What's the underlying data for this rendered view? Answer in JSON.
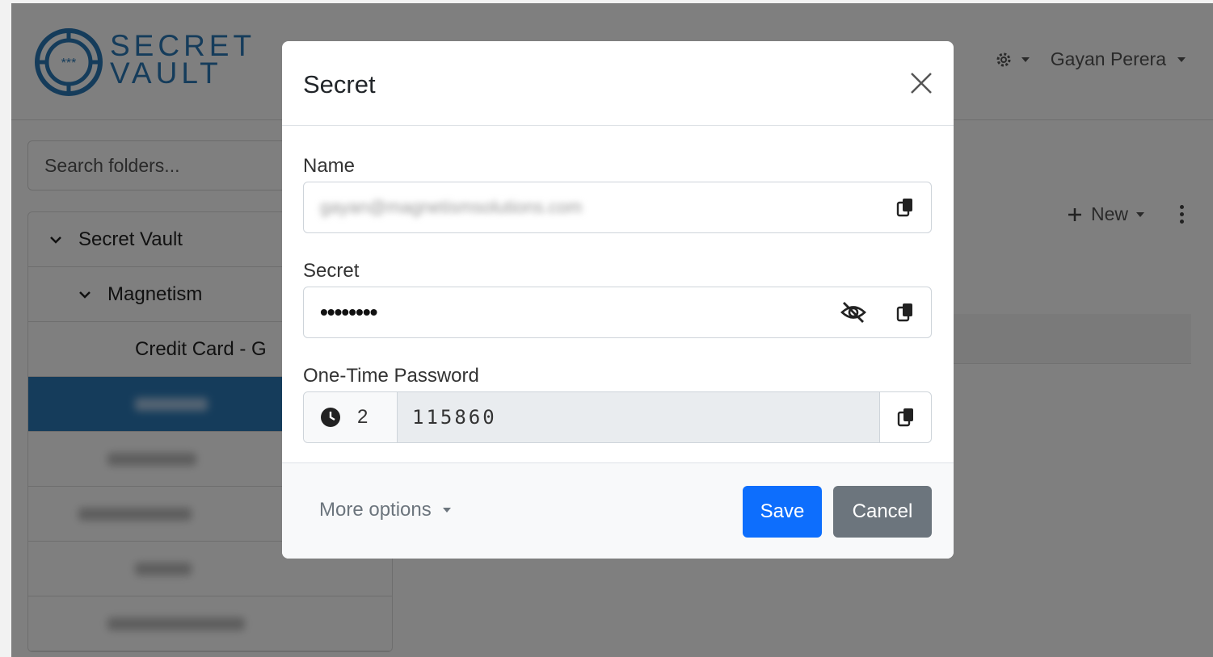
{
  "header": {
    "logo_line1": "SECRET",
    "logo_line2": "VAULT",
    "user_name": "Gayan Perera"
  },
  "sidebar": {
    "search_placeholder": "Search folders...",
    "items": [
      {
        "label": "Secret Vault",
        "level": 0,
        "expanded": true
      },
      {
        "label": "Magnetism",
        "level": 1,
        "expanded": true
      },
      {
        "label": "Credit Card - G",
        "level": 2
      },
      {
        "label": "",
        "level": 2,
        "active": true,
        "blurred": true
      },
      {
        "label": "",
        "level": 2,
        "blurred": true
      },
      {
        "label": "",
        "level": 1,
        "blurred": true
      },
      {
        "label": "",
        "level": 2,
        "blurred": true
      },
      {
        "label": "",
        "level": 2,
        "blurred": true
      }
    ]
  },
  "toolbar": {
    "new_label": "New"
  },
  "modal": {
    "title": "Secret",
    "name_label": "Name",
    "name_value": "gayan@magnetismsolutions.com",
    "secret_label": "Secret",
    "secret_value": "••••••••",
    "otp_label": "One-Time Password",
    "otp_seconds": "2",
    "otp_code": "115860",
    "more_options": "More options",
    "save_label": "Save",
    "cancel_label": "Cancel"
  },
  "colors": {
    "brand": "#2b79b7",
    "primary": "#0d6efd",
    "secondary": "#6c757d"
  },
  "icons": [
    "close-icon",
    "copy-icon",
    "eye-slash-icon",
    "clock-icon",
    "gear-icon",
    "plus-icon",
    "kebab-icon",
    "chevron-down-icon"
  ]
}
